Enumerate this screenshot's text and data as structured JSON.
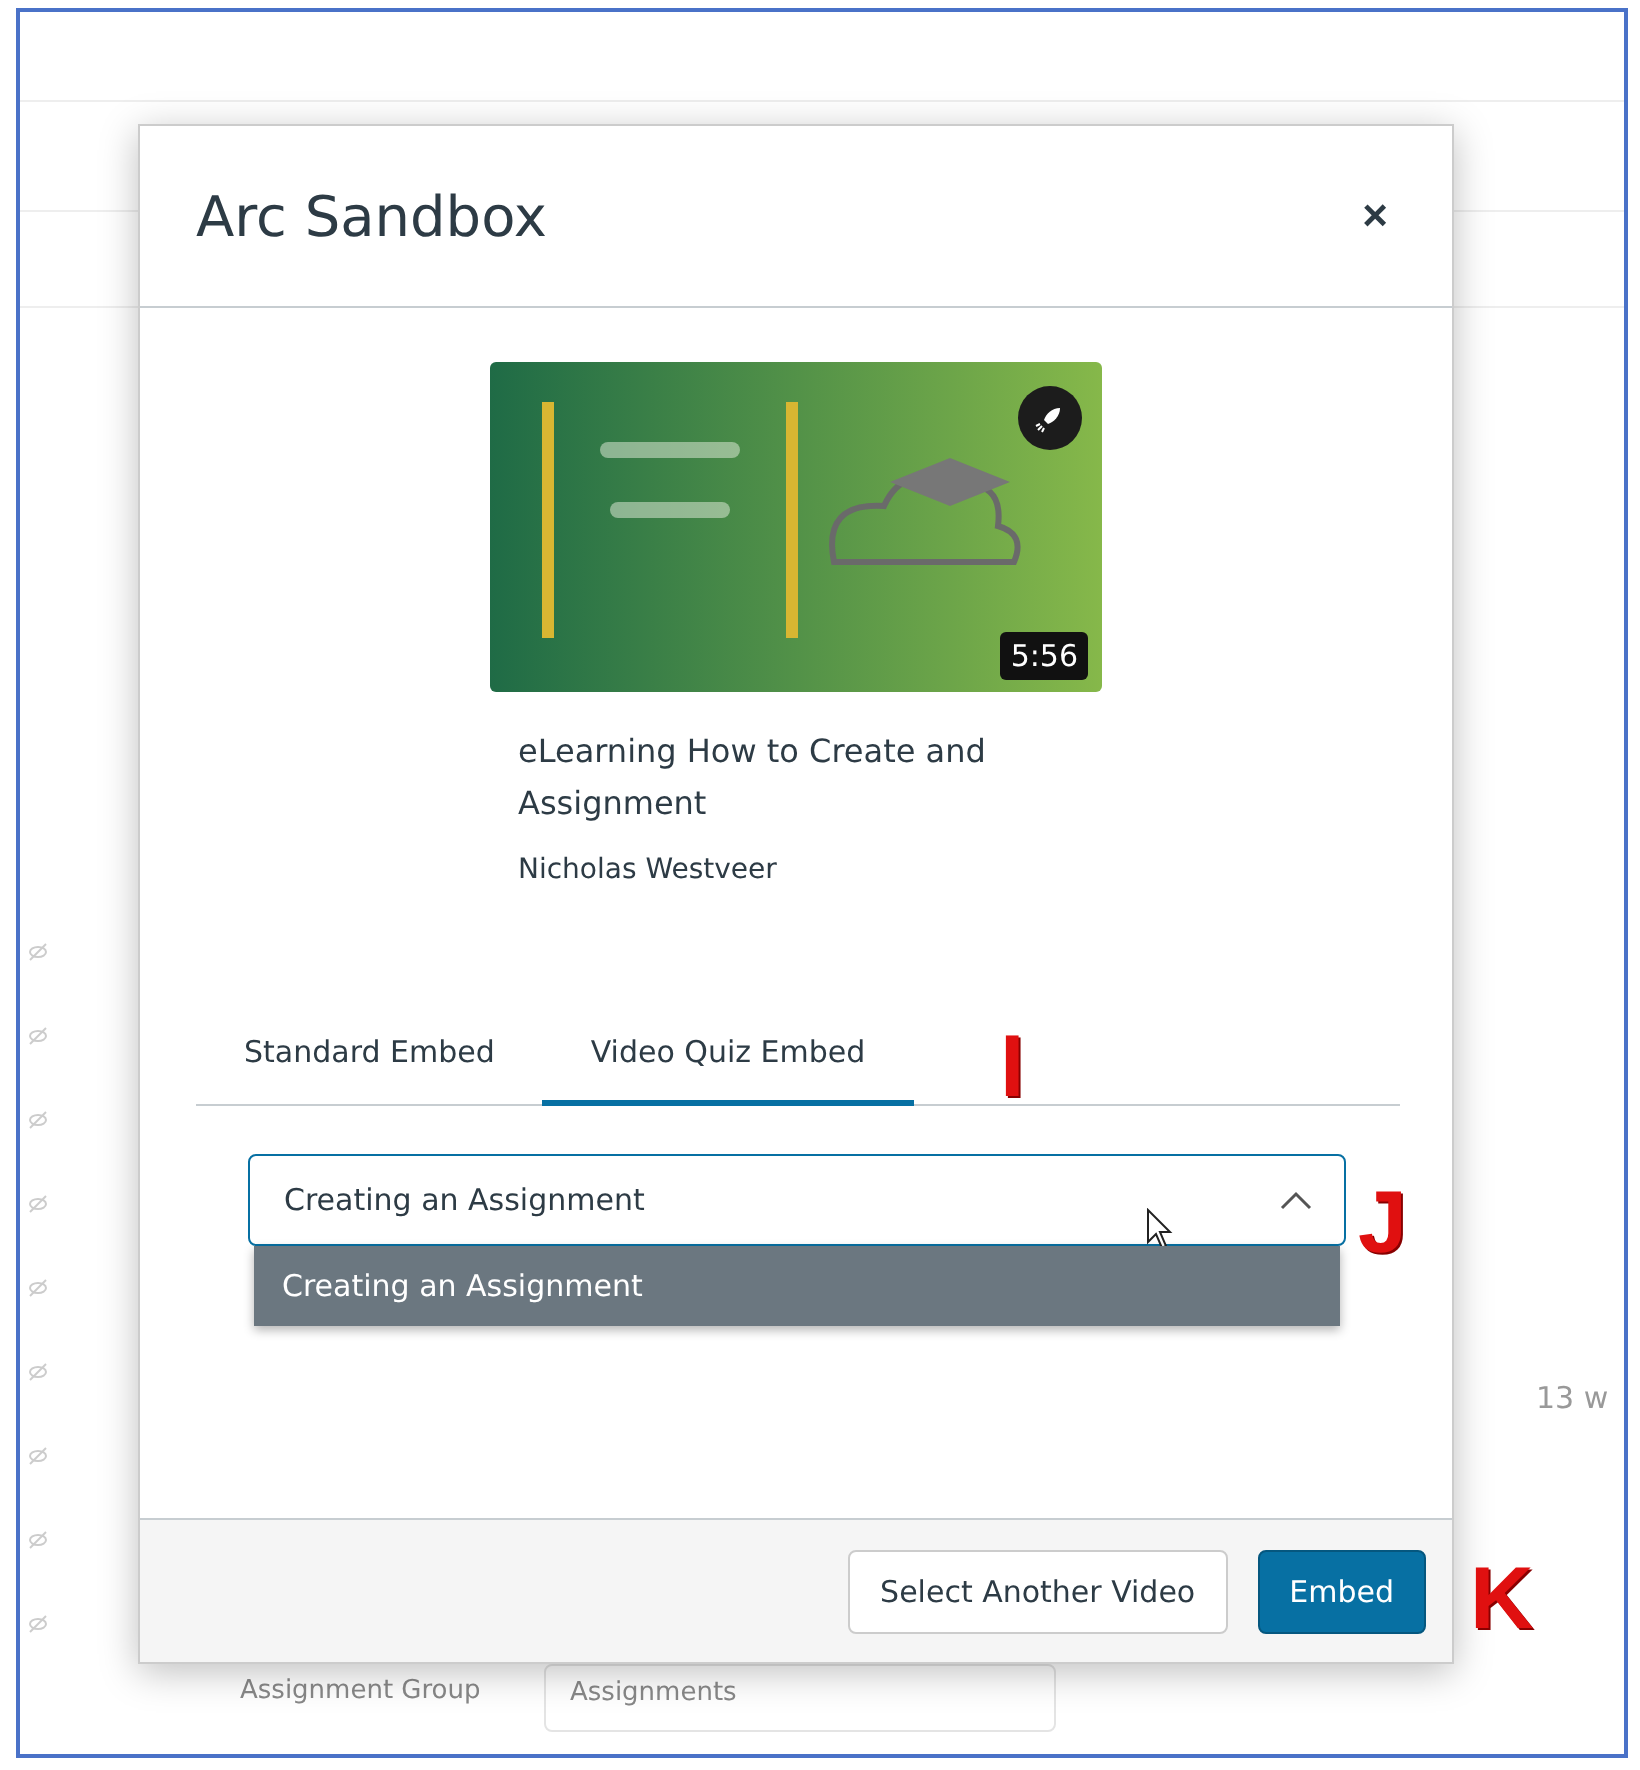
{
  "background": {
    "word_count": "13 w",
    "field_label": "Assignment Group",
    "field_value": "Assignments"
  },
  "dialog": {
    "title": "Arc Sandbox",
    "close": "×",
    "video": {
      "duration": "5:56",
      "title": "eLearning How to Create and Assignment",
      "author": "Nicholas Westveer"
    },
    "tabs": [
      {
        "label": "Standard Embed",
        "selected": false
      },
      {
        "label": "Video Quiz Embed",
        "selected": true
      }
    ],
    "quiz_select": {
      "value": "Creating an Assignment",
      "expanded": true,
      "options": [
        {
          "label": "Creating an Assignment",
          "selected": true
        }
      ]
    },
    "buttons": [
      {
        "label": "Select Another Video",
        "kind": "secondary"
      },
      {
        "label": "Embed",
        "kind": "primary"
      }
    ]
  },
  "annotations": [
    "I",
    "J",
    "K"
  ]
}
